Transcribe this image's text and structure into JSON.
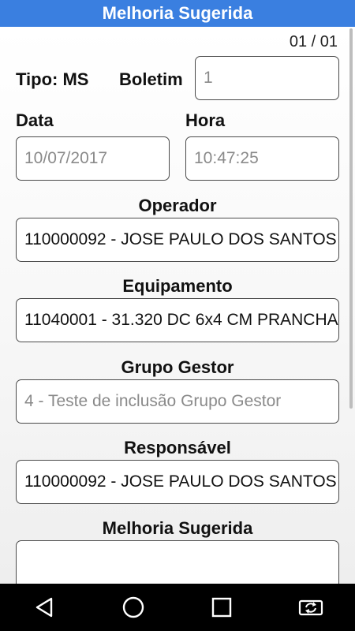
{
  "app": {
    "title": "Melhoria Sugerida",
    "record_counter": "01 / 01"
  },
  "form": {
    "tipo_label": "Tipo: MS",
    "boletim": {
      "label": "Boletim",
      "value": "1"
    },
    "data": {
      "label": "Data",
      "value": "10/07/2017"
    },
    "hora": {
      "label": "Hora",
      "value": "10:47:25"
    },
    "operador": {
      "label": "Operador",
      "value": "110000092 - JOSE PAULO DOS SANTOS"
    },
    "equipamento": {
      "label": "Equipamento",
      "value": "11040001 - 31.320 DC 6x4 CM PRANCHA"
    },
    "grupo_gestor": {
      "label": "Grupo Gestor",
      "value": "4 - Teste de inclusão Grupo Gestor"
    },
    "responsavel": {
      "label": "Responsável",
      "value": "110000092 - JOSE PAULO DOS SANTOS"
    },
    "melhoria": {
      "label": "Melhoria Sugerida",
      "value": ""
    }
  },
  "navbar": {
    "icons": [
      "back-icon",
      "home-icon",
      "recents-icon",
      "screen-rotate-icon"
    ]
  },
  "colors": {
    "header": "#3a7fe0",
    "navbar": "#000000"
  }
}
